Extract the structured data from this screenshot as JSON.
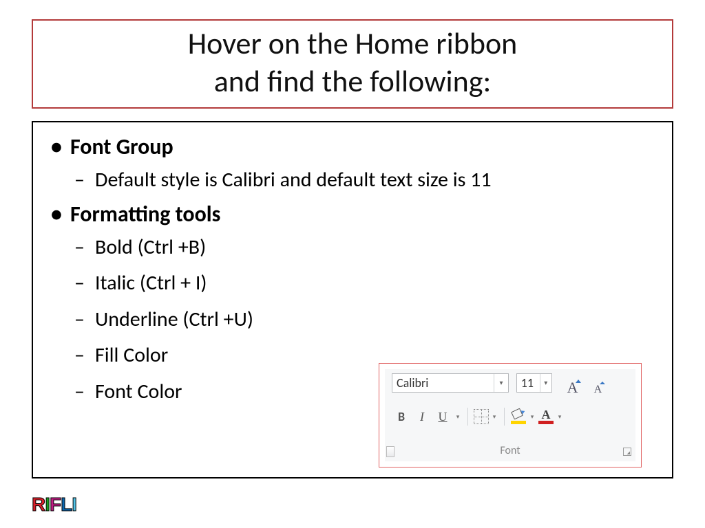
{
  "title": {
    "line1": "Hover on the Home ribbon",
    "line2": "and find the following:"
  },
  "bullets": {
    "font_group": "Font Group",
    "font_group_sub": "Default style is Calibri and default text size is 11",
    "formatting_tools": "Formatting tools",
    "ft_bold": "Bold (Ctrl +B)",
    "ft_italic": "Italic (Ctrl + I)",
    "ft_underline": "Underline  (Ctrl +U)",
    "ft_fill": "Fill Color",
    "ft_fontcolor": "Font Color"
  },
  "ribbon": {
    "font_name": "Calibri",
    "font_size": "11",
    "grow": "A",
    "shrink": "A",
    "bold": "B",
    "italic": "I",
    "underline": "U",
    "fontcolor_glyph": "A",
    "group_label": "Font"
  },
  "logo": {
    "c1": "R",
    "c2": "I",
    "c3": "F",
    "c4": "L",
    "c5": "I"
  }
}
